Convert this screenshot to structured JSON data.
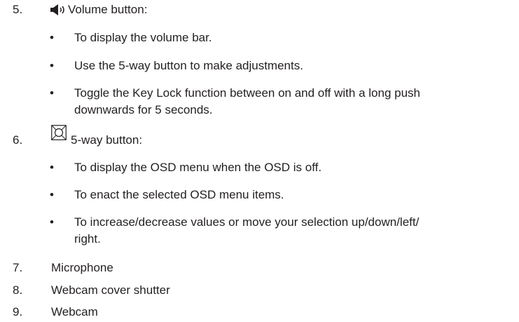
{
  "items": [
    {
      "number": "5.",
      "icon": "speaker-volume-icon",
      "title": "Volume button:",
      "bullets": [
        {
          "symbol": "•",
          "lines": [
            "To display the volume bar."
          ]
        },
        {
          "symbol": "•",
          "lines": [
            "Use the 5-way button to make adjustments."
          ]
        },
        {
          "symbol": "•",
          "lines": [
            "Toggle the Key Lock function between on and off with a long push",
            "downwards for 5 seconds."
          ]
        }
      ]
    },
    {
      "number": "6.",
      "icon": "five-way-button-icon",
      "title": "5-way button:",
      "bullets": [
        {
          "symbol": "•",
          "lines": [
            "To display the OSD menu when the OSD is off."
          ]
        },
        {
          "symbol": "•",
          "lines": [
            "To enact the selected OSD menu items."
          ]
        },
        {
          "symbol": "•",
          "lines": [
            "To increase/decrease values or move your selection up/down/left/",
            "right."
          ]
        }
      ]
    },
    {
      "number": "7.",
      "title": "Microphone"
    },
    {
      "number": "8.",
      "title": "Webcam cover shutter"
    },
    {
      "number": "9.",
      "title": "Webcam"
    }
  ]
}
